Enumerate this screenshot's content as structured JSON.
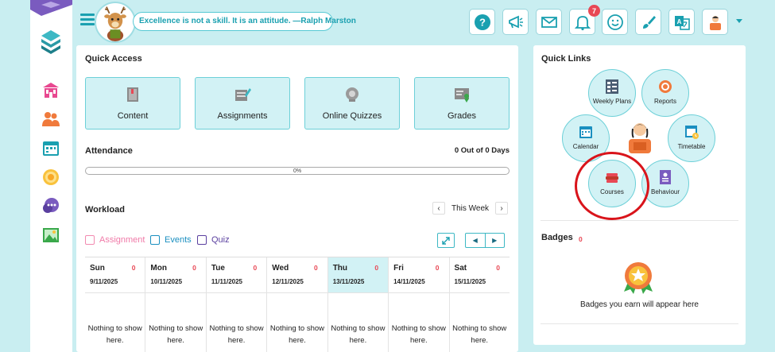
{
  "topbar": {
    "quote": "Excellence is not a skill. It is an attitude. —Ralph Marston",
    "notifications_count": "7"
  },
  "quick_access": {
    "title": "Quick Access",
    "tiles": [
      {
        "label": "Content",
        "icon": "book-icon"
      },
      {
        "label": "Assignments",
        "icon": "assignment-icon"
      },
      {
        "label": "Online Quizzes",
        "icon": "quiz-icon"
      },
      {
        "label": "Grades",
        "icon": "grades-icon"
      }
    ]
  },
  "attendance": {
    "title": "Attendance",
    "summary": "0 Out of 0 Days",
    "progress_label": "0%",
    "progress_value": 0
  },
  "workload": {
    "title": "Workload",
    "week_label": "This Week",
    "legend": {
      "assignment": "Assignment",
      "events": "Events",
      "quiz": "Quiz"
    },
    "days": [
      {
        "name": "Sun",
        "date": "9/11/2025",
        "count": "0",
        "empty": "Nothing to show here."
      },
      {
        "name": "Mon",
        "date": "10/11/2025",
        "count": "0",
        "empty": "Nothing to show here."
      },
      {
        "name": "Tue",
        "date": "11/11/2025",
        "count": "0",
        "empty": "Nothing to show here."
      },
      {
        "name": "Wed",
        "date": "12/11/2025",
        "count": "0",
        "empty": "Nothing to show here."
      },
      {
        "name": "Thu",
        "date": "13/11/2025",
        "count": "0",
        "empty": "Nothing to show here."
      },
      {
        "name": "Fri",
        "date": "14/11/2025",
        "count": "0",
        "empty": "Nothing to show here."
      },
      {
        "name": "Sat",
        "date": "15/11/2025",
        "count": "0",
        "empty": "Nothing to show here."
      }
    ]
  },
  "quick_links": {
    "title": "Quick Links",
    "items": {
      "weekly_plans": "Weekly Plans",
      "reports": "Reports",
      "calendar": "Calendar",
      "timetable": "Timetable",
      "courses": "Courses",
      "behaviour": "Behaviour"
    }
  },
  "badges": {
    "title": "Badges",
    "count": "0",
    "empty": "Badges you earn will appear here"
  },
  "colors": {
    "accent": "#1aa0b0",
    "tile_bg": "#d2f2f5",
    "alert": "#e84855",
    "highlight_ring": "#d9141b"
  }
}
